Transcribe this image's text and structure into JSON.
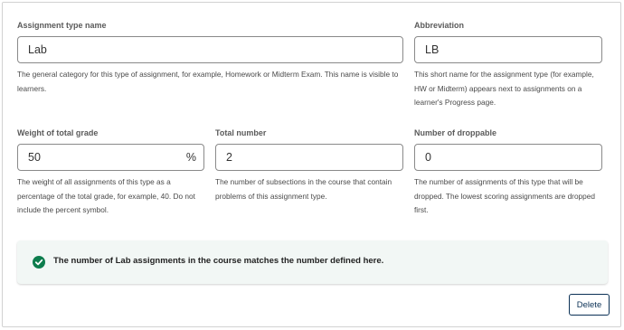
{
  "assignment_type_name": {
    "label": "Assignment type name",
    "value": "Lab",
    "help": "The general category for this type of assignment, for example, Homework or Midterm Exam. This name is visible to learners."
  },
  "abbreviation": {
    "label": "Abbreviation",
    "value": "LB",
    "help": "This short name for the assignment type (for example, HW or Midterm) appears next to assignments on a learner's Progress page."
  },
  "weight": {
    "label": "Weight of total grade",
    "value": "50",
    "suffix": "%",
    "help": "The weight of all assignments of this type as a percentage of the total grade, for example, 40. Do not include the percent symbol."
  },
  "total_number": {
    "label": "Total number",
    "value": "2",
    "help": "The number of subsections in the course that contain problems of this assignment type."
  },
  "droppable": {
    "label": "Number of droppable",
    "value": "0",
    "help": "The number of assignments of this type that will be dropped. The lowest scoring assignments are dropped first."
  },
  "alert": {
    "icon": "check-circle-icon",
    "text": "The number of Lab assignments in the course matches the number defined here."
  },
  "delete_label": "Delete",
  "colors": {
    "success": "#0d7d4d",
    "primary": "#0a3055",
    "alert_bg": "#f2f7f5"
  }
}
